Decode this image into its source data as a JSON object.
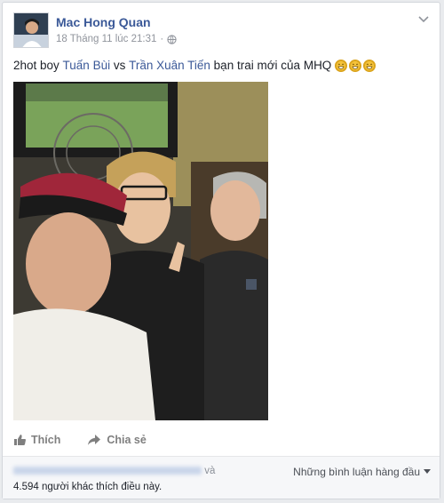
{
  "post": {
    "author_name": "Mac Hong Quan",
    "timestamp": "18 Tháng 11 lúc 21:31",
    "dot": "·",
    "status": {
      "prefix": "2hot boy ",
      "mention1": "Tuấn Bùi",
      "middle": " vs ",
      "mention2": "Trần Xuân Tiến",
      "suffix": " bạn trai mới của MHQ"
    },
    "emojis": [
      "grinning-emoji",
      "grinning-emoji",
      "grinning-emoji"
    ]
  },
  "actions": {
    "like_label": "Thích",
    "share_label": "Chia sẻ"
  },
  "footer": {
    "likers_suffix": "và",
    "likers_count_text": "4.594 người khác",
    "likers_tail": " thích điều này.",
    "sort_label": "Những bình luận hàng đầu"
  },
  "colors": {
    "link": "#3b5998",
    "meta": "#90949c",
    "background": "#e9ebee"
  },
  "icons": {
    "privacy": "globe-icon",
    "menu": "chevron-down-icon",
    "like": "thumbs-up-icon",
    "share": "share-arrow-icon",
    "sort": "caret-down-icon"
  }
}
